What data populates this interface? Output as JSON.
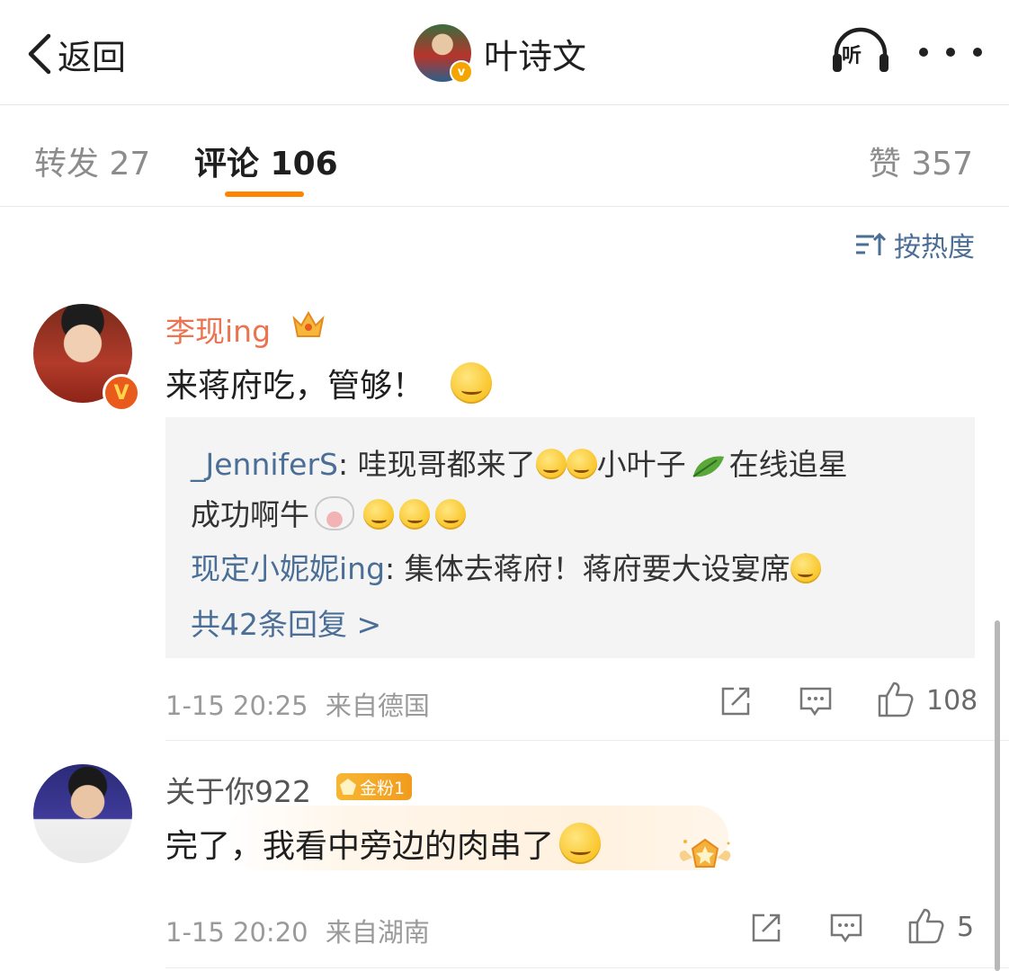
{
  "header": {
    "back_label": "返回",
    "title": "叶诗文",
    "listen_glyph": "听"
  },
  "tabs": {
    "reposts": "转发 27",
    "comments": "评论 106",
    "likes": "赞 357"
  },
  "sort": {
    "label": "按热度"
  },
  "comments": [
    {
      "user": "李现ing",
      "text": "来蒋府吃，管够！",
      "replies": [
        {
          "user": "_JenniferS",
          "sep": ": ",
          "text_a": "哇现哥都来了",
          "text_b": "小叶子",
          "text_c": "在线追星",
          "text_d": "成功啊牛"
        },
        {
          "user": "现定小妮妮ing",
          "sep": ": ",
          "text": "集体去蒋府！蒋府要大设宴席"
        }
      ],
      "more_replies": "共42条回复 >",
      "time": "1-15 20:25",
      "location": "来自德国",
      "likes": "108"
    },
    {
      "user": "关于你922",
      "badge": "金粉1",
      "text": "完了，我看中旁边的肉串了",
      "time": "1-15 20:20",
      "location": "来自湖南",
      "likes": "5"
    }
  ],
  "colors": {
    "accent": "#ff8200",
    "vip_name": "#eb7350",
    "link": "#4a6e96",
    "meta": "#9a9a9a"
  }
}
